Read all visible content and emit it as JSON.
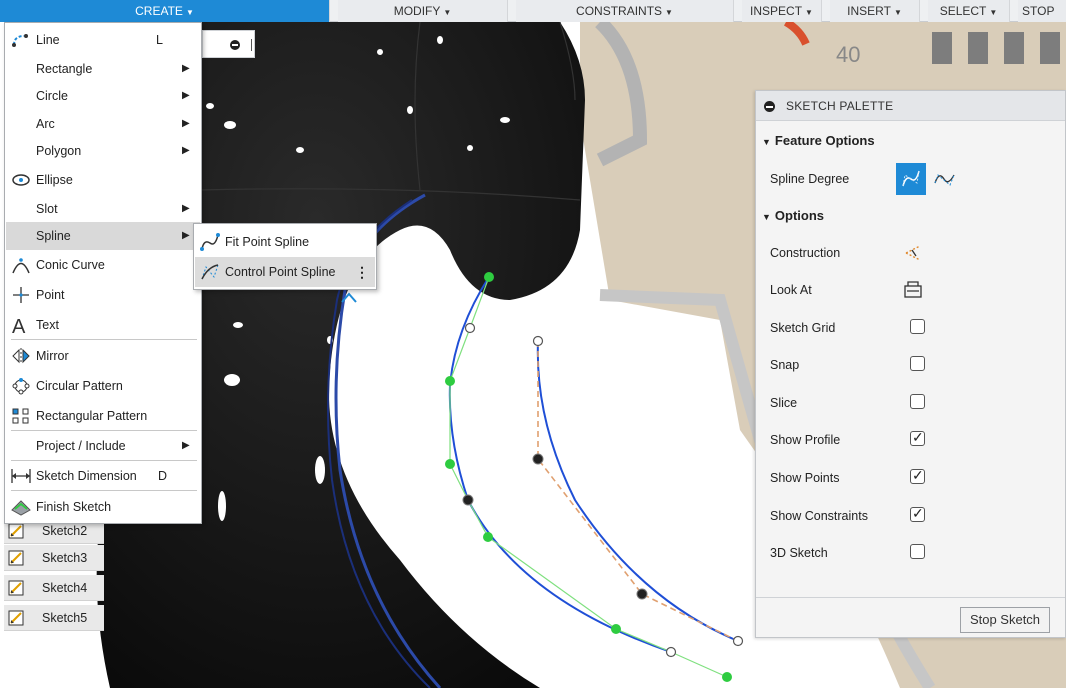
{
  "toolbar": {
    "items": [
      {
        "label": "CREATE"
      },
      {
        "label": "MODIFY"
      },
      {
        "label": "CONSTRAINTS"
      },
      {
        "label": "INSPECT"
      },
      {
        "label": "INSERT"
      },
      {
        "label": "SELECT"
      },
      {
        "label": "STOP"
      }
    ]
  },
  "create_menu": {
    "items": [
      {
        "label": "Line",
        "shortcut": "L",
        "icon": "line-icon"
      },
      {
        "label": "Rectangle",
        "icon": "none"
      },
      {
        "label": "Circle",
        "icon": "none"
      },
      {
        "label": "Arc",
        "icon": "none"
      },
      {
        "label": "Polygon",
        "icon": "none"
      },
      {
        "label": "Ellipse",
        "icon": "ellipse-icon"
      },
      {
        "label": "Slot",
        "icon": "none"
      },
      {
        "label": "Spline",
        "icon": "none"
      },
      {
        "label": "Conic Curve",
        "icon": "conic-curve-icon"
      },
      {
        "label": "Point",
        "icon": "point-icon"
      },
      {
        "label": "Text",
        "icon": "text-icon"
      },
      {
        "label": "Mirror",
        "icon": "mirror-icon"
      },
      {
        "label": "Circular Pattern",
        "icon": "circular-pattern-icon"
      },
      {
        "label": "Rectangular Pattern",
        "icon": "rectangular-pattern-icon"
      },
      {
        "label": "Project / Include",
        "icon": "none"
      },
      {
        "label": "Sketch Dimension",
        "shortcut": "D",
        "icon": "sketch-dimension-icon"
      },
      {
        "label": "Finish Sketch",
        "icon": "finish-sketch-icon"
      }
    ]
  },
  "spline_submenu": {
    "items": [
      {
        "label": "Fit Point Spline",
        "icon": "fit-point-spline-icon"
      },
      {
        "label": "Control Point Spline",
        "icon": "control-point-spline-icon"
      }
    ]
  },
  "browser": {
    "sketches": [
      {
        "label": "Sketch2"
      },
      {
        "label": "Sketch3"
      },
      {
        "label": "Sketch4"
      },
      {
        "label": "Sketch5"
      }
    ]
  },
  "viewcube": {
    "dial_number": "40"
  },
  "palette": {
    "title": "SKETCH PALETTE",
    "feature_options": "Feature Options",
    "spline_degree": "Spline Degree",
    "options": "Options",
    "rows": [
      {
        "label": "Construction",
        "type": "icon",
        "icon": "construction-icon"
      },
      {
        "label": "Look At",
        "type": "icon",
        "icon": "look-at-icon"
      },
      {
        "label": "Sketch Grid",
        "type": "checkbox",
        "checked": false
      },
      {
        "label": "Snap",
        "type": "checkbox",
        "checked": false
      },
      {
        "label": "Slice",
        "type": "checkbox",
        "checked": false
      },
      {
        "label": "Show Profile",
        "type": "checkbox",
        "checked": true
      },
      {
        "label": "Show Points",
        "type": "checkbox",
        "checked": true
      },
      {
        "label": "Show Constraints",
        "type": "checkbox",
        "checked": true
      },
      {
        "label": "3D Sketch",
        "type": "checkbox",
        "checked": false
      }
    ],
    "stop_sketch": "Stop Sketch"
  },
  "colors": {
    "accent": "#1e8ad6",
    "spline_blue": "#1f4fd6",
    "point_green": "#2ecc40",
    "control_polygon": "#e0a070"
  }
}
